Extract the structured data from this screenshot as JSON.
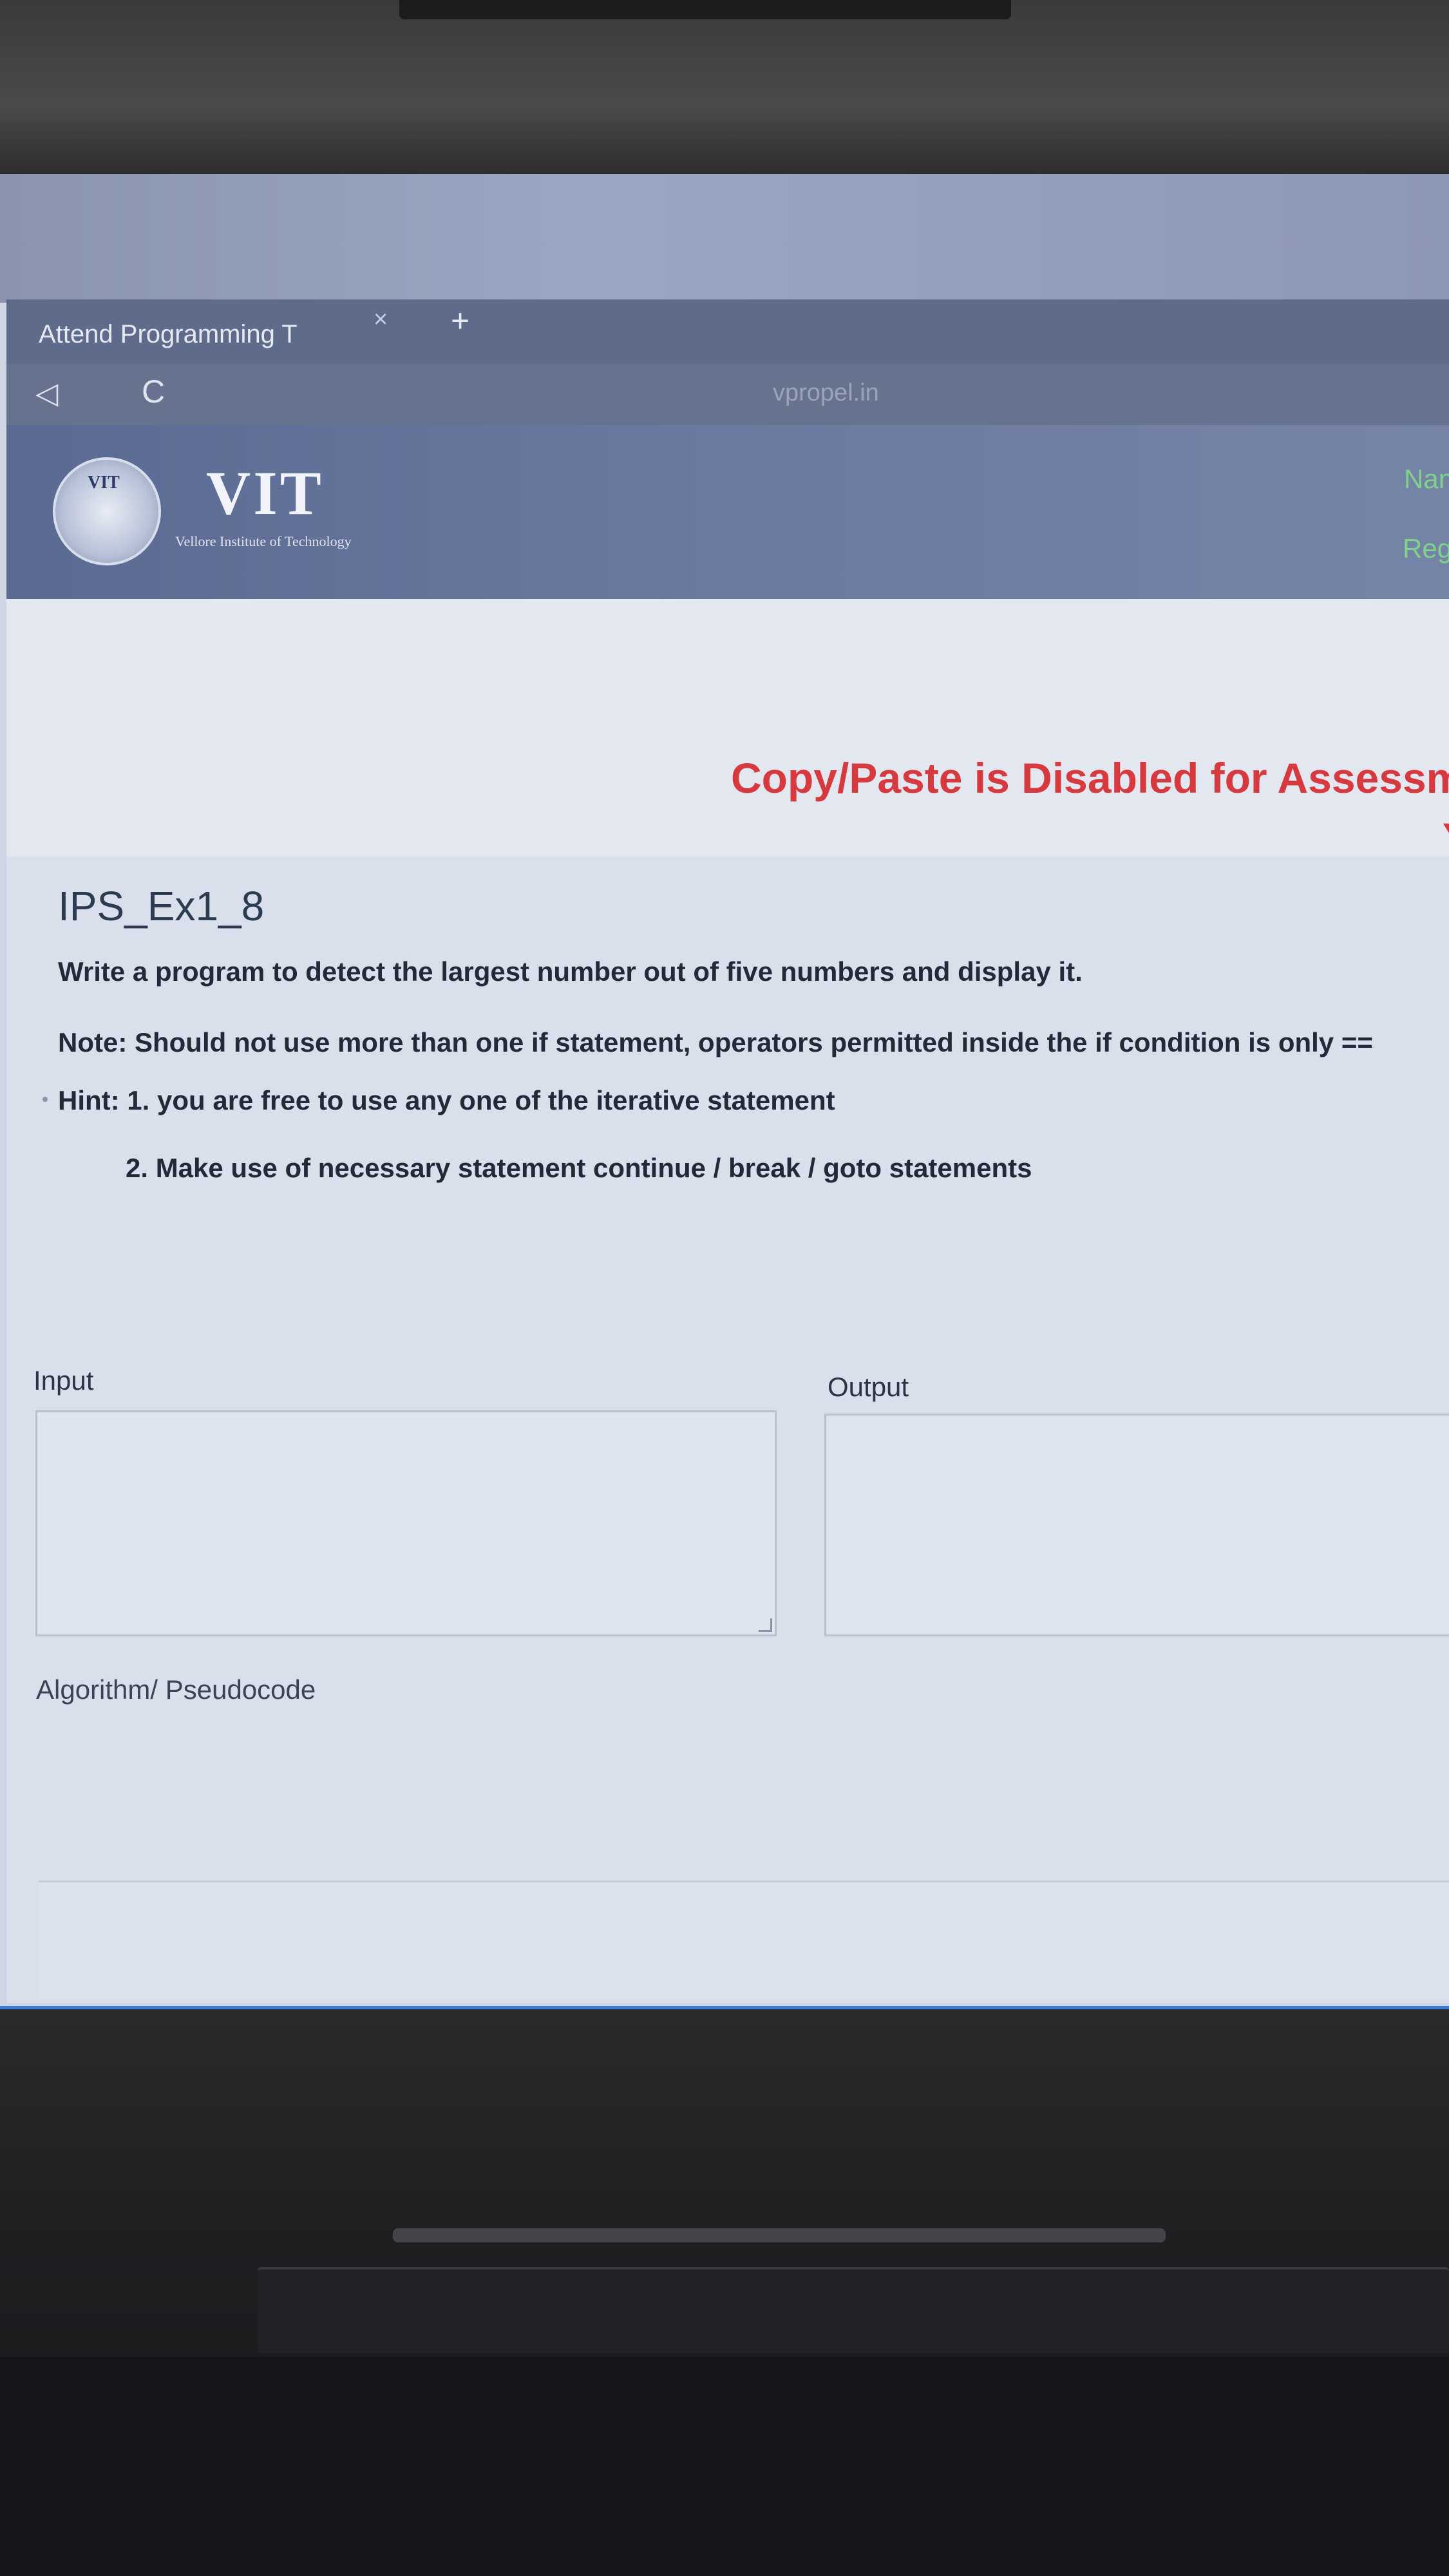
{
  "browser": {
    "tab_title": "Attend Programming T",
    "tab_close": "×",
    "tab_new": "+",
    "back_icon": "◁",
    "reload_icon": "C",
    "url": "vpropel.in"
  },
  "header": {
    "logo_seal_text": "VIT",
    "logo_text": "VIT",
    "logo_subtitle": "Vellore Institute of Technology",
    "name_label": "Nan",
    "reg_label": "Reg"
  },
  "banner": {
    "text": "Copy/Paste is Disabled for Assessment",
    "trailing": "Y"
  },
  "question": {
    "title": "IPS_Ex1_8",
    "statement": "Write a program to detect the largest number out of five numbers and display it.",
    "note": "Note: Should not use more than one if statement, operators permitted inside the if condition is only ==",
    "hint_1": "Hint:  1. you are free to use any one of the iterative statement",
    "hint_2": "2. Make use of necessary statement continue / break / goto statements"
  },
  "form": {
    "input_label": "Input",
    "output_label": "Output",
    "algorithm_label": "Algorithm/ Pseudocode"
  }
}
